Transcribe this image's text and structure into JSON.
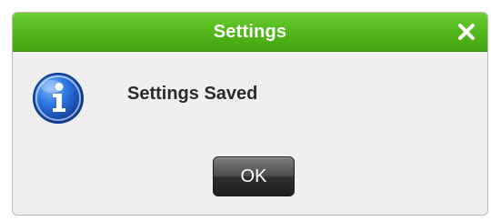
{
  "dialog": {
    "title": "Settings",
    "message": "Settings Saved",
    "ok_label": "OK",
    "close_icon": "close-icon",
    "message_icon": "info-icon"
  },
  "colors": {
    "titlebar": "#53b91c",
    "body": "#efefef",
    "button": "#2e2e2e",
    "icon": "#1f5fc8"
  }
}
